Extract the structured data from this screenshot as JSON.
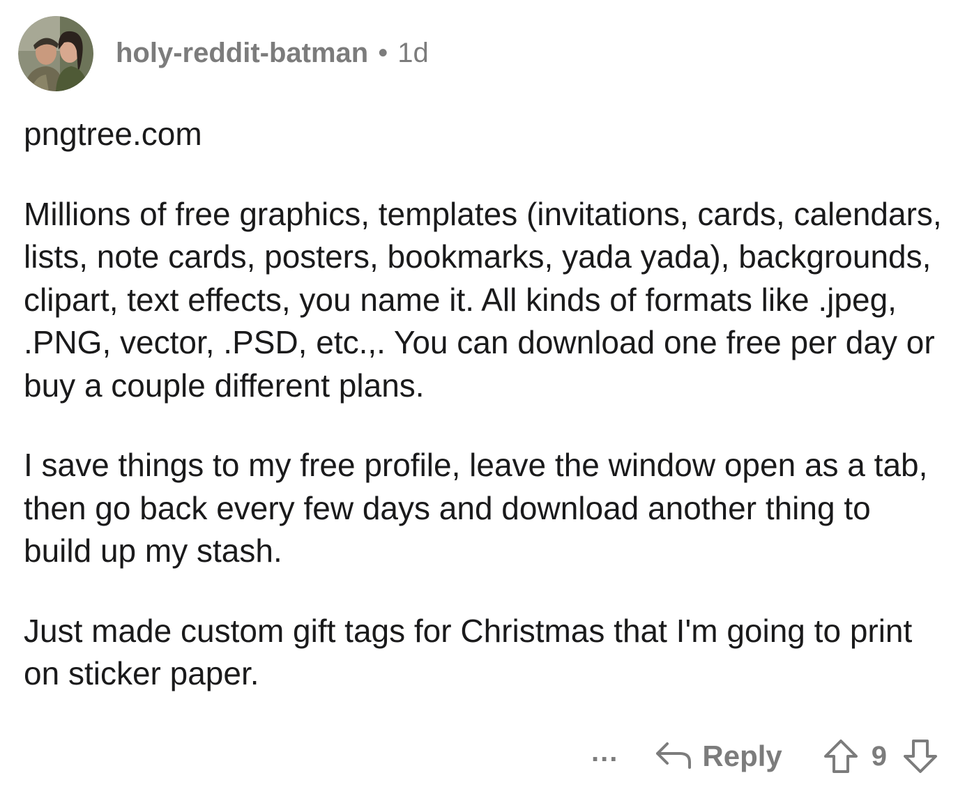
{
  "comment": {
    "author": "holy-reddit-batman",
    "separator": "•",
    "age": "1d",
    "paragraphs": [
      "pngtree.com",
      "Millions of free graphics, templates (invitations, cards, calendars, lists, note cards, posters, bookmarks, yada yada), backgrounds, clipart, text effects, you name it. All kinds of formats like .jpeg, .PNG, vector, .PSD, etc.,. You can download one free per day or buy a couple different plans.",
      "I save things to my free profile, leave the window open as a tab, then go back every few days and download another thing to build up my stash.",
      "Just made custom gift tags for Christmas that I'm going to print on sticker paper."
    ],
    "actions": {
      "more_label": "...",
      "reply_label": "Reply",
      "vote_count": "9"
    }
  },
  "icons": {
    "avatar": "avatar-photo",
    "reply": "reply-arrow-icon",
    "upvote": "upvote-arrow-icon",
    "downvote": "downvote-arrow-icon"
  },
  "colors": {
    "text": "#1a1a1b",
    "meta": "#7c7c7c",
    "background": "#ffffff"
  }
}
